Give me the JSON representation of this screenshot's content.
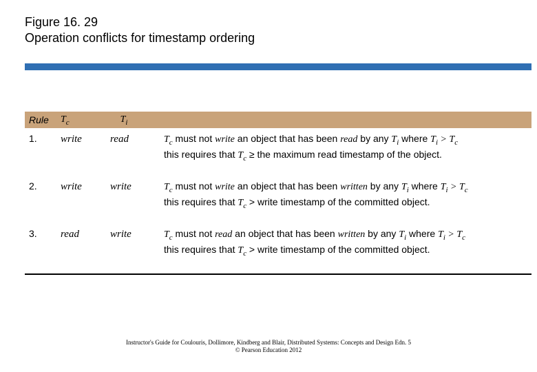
{
  "figure": {
    "number": "Figure 16. 29",
    "title": "Operation conflicts for timestamp ordering"
  },
  "table": {
    "header": {
      "rule": "Rule",
      "tc": "T",
      "tc_sub": "c",
      "ti": "T",
      "ti_sub": "i"
    },
    "rows": [
      {
        "num": "1.",
        "tc": "write",
        "ti": "read",
        "line1a": "T",
        "line1b": "c",
        "line1c": " must not ",
        "line1d": "write",
        "line1e": " an object that has been ",
        "line1f": "read",
        "line1g": " by any ",
        "line1h": "T",
        "line1i": "i",
        "line1j": " where ",
        "line1k": "T",
        "line1l": "i",
        "line1m": " > ",
        "line1n": "T",
        "line1o": "c",
        "line2a": "this requires that  ",
        "line2b": "T",
        "line2c": "c",
        "line2d": " ≥ the maximum read timestamp of the object."
      },
      {
        "num": "2.",
        "tc": "write",
        "ti": "write",
        "line1a": "T",
        "line1b": "c",
        "line1c": " must not ",
        "line1d": "write",
        "line1e": " an object that has been ",
        "line1f": "written",
        "line1g": " by any ",
        "line1h": "T",
        "line1i": "i",
        "line1j": " where ",
        "line1k": "T",
        "line1l": "i",
        "line1m": " > ",
        "line1n": "T",
        "line1o": "c",
        "line2a": "this requires that  ",
        "line2b": "T",
        "line2c": "c",
        "line2d": " > write timestamp of the committed object."
      },
      {
        "num": "3.",
        "tc": "read",
        "ti": "write",
        "line1a": "T",
        "line1b": "c",
        "line1c": " must not ",
        "line1d": "read",
        "line1e": " an object that has been ",
        "line1f": "written",
        "line1g": " by any ",
        "line1h": "T",
        "line1i": "i",
        "line1j": " where ",
        "line1k": "T",
        "line1l": "i",
        "line1m": " > ",
        "line1n": "T",
        "line1o": "c",
        "line2a": "this requires that  ",
        "line2b": "T",
        "line2c": "c",
        "line2d": "  > write timestamp of the committed object."
      }
    ]
  },
  "footer": {
    "line1": "Instructor's Guide for  Coulouris, Dollimore, Kindberg and Blair,  Distributed Systems: Concepts and Design   Edn. 5",
    "line2": "©  Pearson Education 2012"
  }
}
